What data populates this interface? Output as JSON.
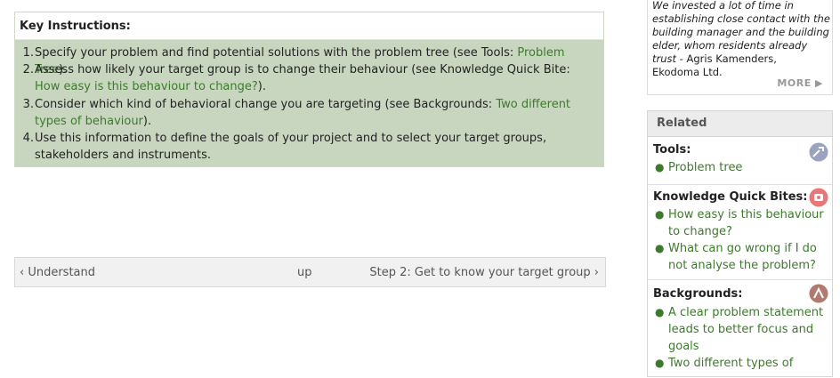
{
  "key_instructions": {
    "title": "Key Instructions:",
    "items": [
      {
        "num": "1.",
        "pre": "Specify your problem and find potential solutions with the problem tree (see Tools: ",
        "link": "Problem Tree",
        "post": ")."
      },
      {
        "num": "2.",
        "pre": "Assess how likely your target group is to change their behaviour (see Knowledge Quick Bite: ",
        "link": "How easy is this behaviour to change?",
        "post": ")."
      },
      {
        "num": "3.",
        "pre": "Consider which kind of behavioral change you are targeting (see Backgrounds: ",
        "link": "Two different types of behaviour",
        "post": ")."
      },
      {
        "num": "4.",
        "pre": "Use this information to define the goals of your project and to select your target groups, stakeholders and instruments.",
        "link": "",
        "post": ""
      }
    ]
  },
  "pager": {
    "prev": "‹ Understand",
    "up": "up",
    "next": "Step 2: Get to know your target group ›"
  },
  "quote": {
    "lines": [
      "We invested a lot of time in",
      "establishing close contact with the",
      "building manager and the building",
      "elder, whom residents already",
      "trust"
    ],
    "author_suffix": " - Agris Kamenders,",
    "org": "Ekodoma Ltd.",
    "more": "MORE ▶"
  },
  "related": {
    "title": "Related",
    "tools": {
      "title": "Tools:",
      "items": [
        "Problem tree"
      ],
      "icon": "tools-icon"
    },
    "kqb": {
      "title": "Knowledge Quick Bites:",
      "items": [
        "How easy is this behaviour to change?",
        "What can go wrong if I do not analyse the problem?"
      ],
      "icon": "knowledge-icon"
    },
    "backgrounds": {
      "title": "Backgrounds:",
      "items": [
        "A clear problem statement leads to better focus and goals",
        "Two different types of"
      ],
      "icon": "backgrounds-icon"
    }
  },
  "colors": {
    "link": "#3d7a2c",
    "box_bg": "#c8d6c0"
  }
}
